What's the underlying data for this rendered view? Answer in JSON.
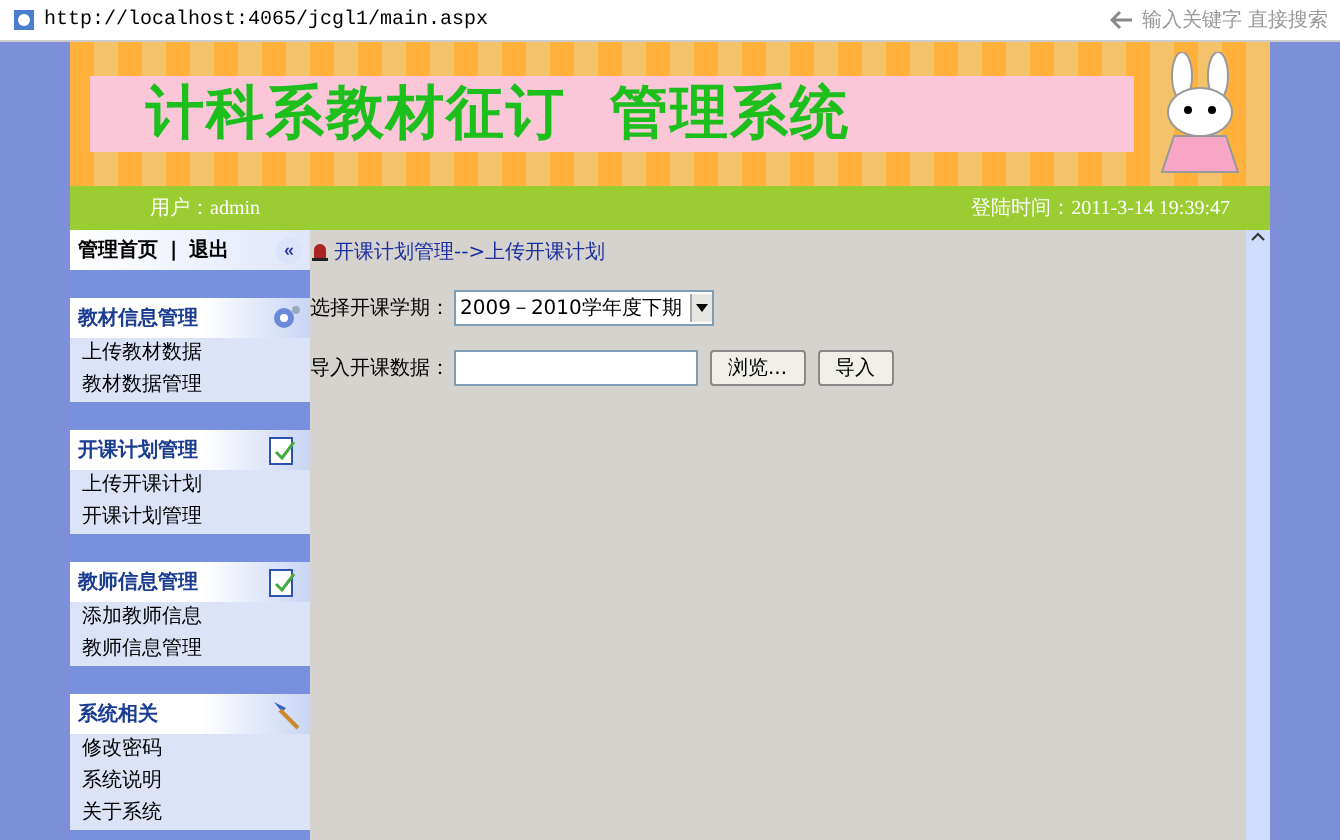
{
  "address_bar": {
    "url": "http://localhost:4065/jcgl1/main.aspx",
    "search_placeholder": "输入关键字 直接搜索"
  },
  "banner": {
    "title": "计科系教材征订  管理系统"
  },
  "info_bar": {
    "user": "用户：admin",
    "login_time": "登陆时间：2011-3-14 19:39:47"
  },
  "sidebar": {
    "top_links": [
      "管理首页",
      "退出"
    ],
    "separator": "|",
    "collapse": "«",
    "groups": [
      {
        "title": "教材信息管理",
        "items": [
          "上传教材数据",
          "教材数据管理"
        ]
      },
      {
        "title": "开课计划管理",
        "items": [
          "上传开课计划",
          "开课计划管理"
        ]
      },
      {
        "title": "教师信息管理",
        "items": [
          "添加教师信息",
          "教师信息管理"
        ]
      },
      {
        "title": "系统相关",
        "items": [
          "修改密码",
          "系统说明",
          "关于系统"
        ]
      }
    ]
  },
  "breadcrumb": "开课计划管理-->上传开课计划",
  "form": {
    "term_label": "选择开课学期：",
    "term_value": "2009－2010学年度下期",
    "import_label": "导入开课数据：",
    "browse_button": "浏览...",
    "import_button": "导入"
  }
}
